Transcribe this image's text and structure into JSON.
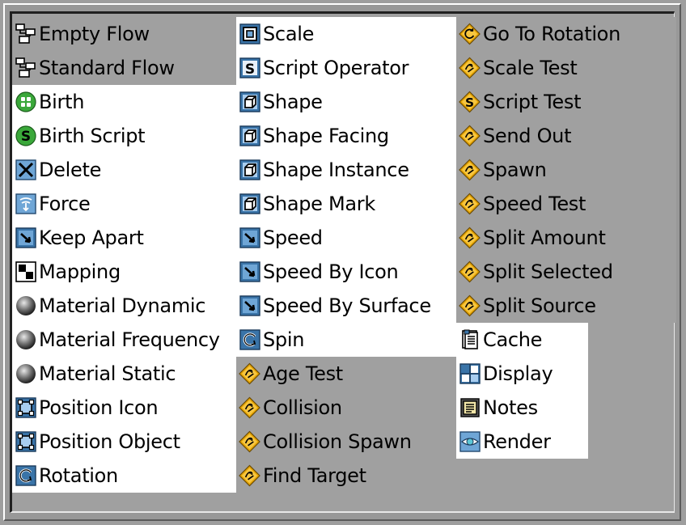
{
  "columns": [
    {
      "items": [
        {
          "label": "Empty Flow",
          "icon": "flow-icon",
          "bg": "g"
        },
        {
          "label": "Standard Flow",
          "icon": "flow-icon",
          "bg": "g"
        },
        {
          "label": "Birth",
          "icon": "birth-icon",
          "bg": "w"
        },
        {
          "label": "Birth Script",
          "icon": "birth-script-icon",
          "bg": "w"
        },
        {
          "label": "Delete",
          "icon": "delete-icon",
          "bg": "w"
        },
        {
          "label": "Force",
          "icon": "force-icon",
          "bg": "w"
        },
        {
          "label": "Keep Apart",
          "icon": "arrow-icon",
          "bg": "w"
        },
        {
          "label": "Mapping",
          "icon": "mapping-icon",
          "bg": "w"
        },
        {
          "label": "Material Dynamic",
          "icon": "sphere-icon",
          "bg": "w"
        },
        {
          "label": "Material Frequency",
          "icon": "sphere-icon",
          "bg": "w"
        },
        {
          "label": "Material Static",
          "icon": "sphere-icon",
          "bg": "w"
        },
        {
          "label": "Position Icon",
          "icon": "position-icon",
          "bg": "w"
        },
        {
          "label": "Position Object",
          "icon": "position-icon",
          "bg": "w"
        },
        {
          "label": "Rotation",
          "icon": "rotation-icon",
          "bg": "w"
        }
      ]
    },
    {
      "items": [
        {
          "label": "Scale",
          "icon": "scale-icon",
          "bg": "w"
        },
        {
          "label": "Script Operator",
          "icon": "script-operator-icon",
          "bg": "w"
        },
        {
          "label": "Shape",
          "icon": "shape-icon",
          "bg": "w"
        },
        {
          "label": "Shape Facing",
          "icon": "shape-icon",
          "bg": "w"
        },
        {
          "label": "Shape Instance",
          "icon": "shape-icon",
          "bg": "w"
        },
        {
          "label": "Shape Mark",
          "icon": "shape-icon",
          "bg": "w"
        },
        {
          "label": "Speed",
          "icon": "arrow-icon",
          "bg": "w"
        },
        {
          "label": "Speed By Icon",
          "icon": "arrow-icon",
          "bg": "w"
        },
        {
          "label": "Speed By Surface",
          "icon": "arrow-icon",
          "bg": "w"
        },
        {
          "label": "Spin",
          "icon": "rotation-icon",
          "bg": "w"
        },
        {
          "label": "Age Test",
          "icon": "test-icon",
          "bg": "g"
        },
        {
          "label": "Collision",
          "icon": "test-icon",
          "bg": "g"
        },
        {
          "label": "Collision Spawn",
          "icon": "test-icon",
          "bg": "g"
        },
        {
          "label": "Find Target",
          "icon": "test-icon",
          "bg": "g"
        }
      ]
    },
    {
      "items": [
        {
          "label": "Go To Rotation",
          "icon": "goto-rotation-icon",
          "bg": "g"
        },
        {
          "label": "Scale Test",
          "icon": "test-icon",
          "bg": "g"
        },
        {
          "label": "Script Test",
          "icon": "script-test-icon",
          "bg": "g"
        },
        {
          "label": "Send Out",
          "icon": "test-icon",
          "bg": "g"
        },
        {
          "label": "Spawn",
          "icon": "test-icon",
          "bg": "g"
        },
        {
          "label": "Speed Test",
          "icon": "test-icon",
          "bg": "g"
        },
        {
          "label": "Split Amount",
          "icon": "test-icon",
          "bg": "g"
        },
        {
          "label": "Split Selected",
          "icon": "test-icon",
          "bg": "g"
        },
        {
          "label": "Split Source",
          "icon": "test-icon",
          "bg": "g"
        },
        {
          "label": "Cache",
          "icon": "cache-icon",
          "bg": "w"
        },
        {
          "label": "Display",
          "icon": "display-icon",
          "bg": "w"
        },
        {
          "label": "Notes",
          "icon": "notes-icon",
          "bg": "w"
        },
        {
          "label": "Render",
          "icon": "render-icon",
          "bg": "w"
        }
      ]
    }
  ],
  "colors": {
    "panel_bg": "#a0a0a0",
    "item_light_bg": "#ffffff",
    "icon_blue": "#3a74a8",
    "test_gold": "#e0a000",
    "birth_green": "#3aa83a"
  }
}
